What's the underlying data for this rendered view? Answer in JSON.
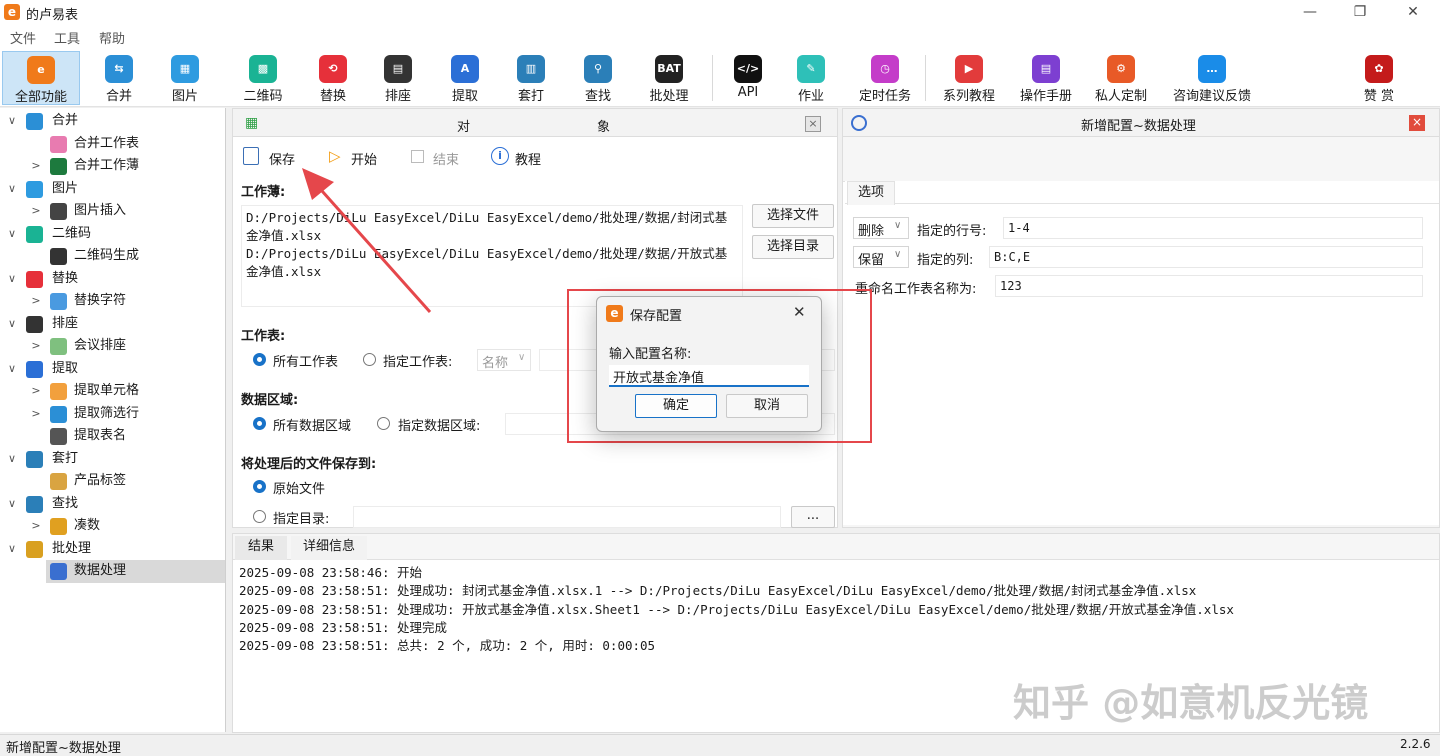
{
  "window": {
    "title": "的卢易表",
    "logo": "e",
    "minimize": "—",
    "maximize": "❐",
    "close": "✕"
  },
  "menu": [
    "文件",
    "工具",
    "帮助"
  ],
  "toolbar": [
    {
      "label": "全部功能",
      "icon": "e",
      "color": "#f07a1a"
    },
    {
      "label": "合并",
      "icon": "⇆",
      "color": "#2b8fd6"
    },
    {
      "label": "图片",
      "icon": "▦",
      "color": "#2e9be0"
    },
    {
      "label": "二维码",
      "icon": "▩",
      "color": "#1ab394"
    },
    {
      "label": "替换",
      "icon": "⟲",
      "color": "#e6303a"
    },
    {
      "label": "排座",
      "icon": "▤",
      "color": "#333333"
    },
    {
      "label": "提取",
      "icon": "A",
      "color": "#2b6fd6"
    },
    {
      "label": "套打",
      "icon": "▥",
      "color": "#2b7fb8"
    },
    {
      "label": "查找",
      "icon": "⚲",
      "color": "#2b7fb8"
    },
    {
      "label": "批处理",
      "icon": "BAT",
      "color": "#222222"
    },
    {
      "label": "API",
      "icon": "</>",
      "color": "#111111"
    },
    {
      "label": "作业",
      "icon": "✎",
      "color": "#2ec0b8"
    },
    {
      "label": "定时任务",
      "icon": "◷",
      "color": "#c43cc9"
    },
    {
      "label": "系列教程",
      "icon": "▶",
      "color": "#e23b3b"
    },
    {
      "label": "操作手册",
      "icon": "▤",
      "color": "#7d3fd1"
    },
    {
      "label": "私人定制",
      "icon": "⚙",
      "color": "#e85a27"
    },
    {
      "label": "咨询建议反馈",
      "icon": "…",
      "color": "#1a8ce8"
    },
    {
      "label": "赞 赏",
      "icon": "✿",
      "color": "#c41b1b"
    }
  ],
  "tree": [
    {
      "label": "合并",
      "level": 0,
      "arrow": "∨",
      "color": "#2b8fd6"
    },
    {
      "label": "合并工作表",
      "level": 1,
      "arrow": "",
      "color": "#e87bb0"
    },
    {
      "label": "合并工作薄",
      "level": 1,
      "arrow": ">",
      "color": "#1d7a3e"
    },
    {
      "label": "图片",
      "level": 0,
      "arrow": "∨",
      "color": "#2e9be0"
    },
    {
      "label": "图片插入",
      "level": 1,
      "arrow": ">",
      "color": "#444444"
    },
    {
      "label": "二维码",
      "level": 0,
      "arrow": "∨",
      "color": "#1ab394"
    },
    {
      "label": "二维码生成",
      "level": 1,
      "arrow": "",
      "color": "#333333"
    },
    {
      "label": "替换",
      "level": 0,
      "arrow": "∨",
      "color": "#e6303a"
    },
    {
      "label": "替换字符",
      "level": 1,
      "arrow": ">",
      "color": "#4a9ae0"
    },
    {
      "label": "排座",
      "level": 0,
      "arrow": "∨",
      "color": "#333333"
    },
    {
      "label": "会议排座",
      "level": 1,
      "arrow": ">",
      "color": "#7fc07f"
    },
    {
      "label": "提取",
      "level": 0,
      "arrow": "∨",
      "color": "#2b6fd6"
    },
    {
      "label": "提取单元格",
      "level": 1,
      "arrow": ">",
      "color": "#f2a03d"
    },
    {
      "label": "提取筛选行",
      "level": 1,
      "arrow": ">",
      "color": "#2b8fd6"
    },
    {
      "label": "提取表名",
      "level": 1,
      "arrow": "",
      "color": "#555555"
    },
    {
      "label": "套打",
      "level": 0,
      "arrow": "∨",
      "color": "#2b7fb8"
    },
    {
      "label": "产品标签",
      "level": 1,
      "arrow": "",
      "color": "#d9a441"
    },
    {
      "label": "查找",
      "level": 0,
      "arrow": "∨",
      "color": "#2b7fb8"
    },
    {
      "label": "凑数",
      "level": 1,
      "arrow": ">",
      "color": "#e0a020"
    },
    {
      "label": "批处理",
      "level": 0,
      "arrow": "∨",
      "color": "#d9a020"
    },
    {
      "label": "数据处理",
      "level": 1,
      "arrow": "",
      "color": "#3a6fd0",
      "selected": true
    }
  ],
  "panel": {
    "title_left": "对",
    "title_right": "象",
    "close": "×",
    "actions": {
      "save": "保存",
      "start": "开始",
      "stop": "结束",
      "tutorial": "教程"
    },
    "workbook_label": "工作薄:",
    "workbooks": [
      "D:/Projects/DiLu EasyExcel/DiLu EasyExcel/demo/批处理/数据/封闭式基",
      "金净值.xlsx",
      "D:/Projects/DiLu EasyExcel/DiLu EasyExcel/demo/批处理/数据/开放式基",
      "金净值.xlsx"
    ],
    "select_file": "选择文件",
    "select_dir": "选择目录",
    "sheet_label": "工作表:",
    "all_sheets": "所有工作表",
    "specified_sheet": "指定工作表:",
    "name_option": "名称",
    "range_label": "数据区域:",
    "all_ranges": "所有数据区域",
    "specified_range": "指定数据区域:",
    "save_to_label": "将处理后的文件保存到:",
    "original_file": "原始文件",
    "specified_dir": "指定目录:",
    "browse": "..."
  },
  "right_panel": {
    "title": "新增配置~数据处理",
    "close": "×",
    "tab": "选项",
    "rows": [
      {
        "select": "删除",
        "label": "指定的行号:",
        "value": "1-4"
      },
      {
        "select": "保留",
        "label": "指定的列:",
        "value": "B:C,E"
      },
      {
        "select": "",
        "label": "重命名工作表名称为:",
        "value": "123"
      }
    ]
  },
  "dialog": {
    "logo": "e",
    "title": "保存配置",
    "close": "✕",
    "prompt": "输入配置名称:",
    "value": "开放式基金净值",
    "ok": "确定",
    "cancel": "取消"
  },
  "log": {
    "tabs": [
      "结果",
      "详细信息"
    ],
    "lines": [
      "2025-09-08 23:58:46: 开始",
      "2025-09-08 23:58:51: 处理成功: 封闭式基金净值.xlsx.1 --> D:/Projects/DiLu EasyExcel/DiLu EasyExcel/demo/批处理/数据/封闭式基金净值.xlsx",
      "2025-09-08 23:58:51: 处理成功: 开放式基金净值.xlsx.Sheet1 --> D:/Projects/DiLu EasyExcel/DiLu EasyExcel/demo/批处理/数据/开放式基金净值.xlsx",
      "2025-09-08 23:58:51: 处理完成",
      "2025-09-08 23:58:51: 总共: 2 个, 成功: 2 个, 用时: 0:00:05"
    ]
  },
  "watermark": "知乎 @如意机反光镜",
  "status": {
    "left": "新增配置~数据处理",
    "version": "2.2.6"
  },
  "colors": {
    "accent": "#1872c8",
    "annotation": "#e5474b",
    "selected_tool": "#cde5f7"
  }
}
